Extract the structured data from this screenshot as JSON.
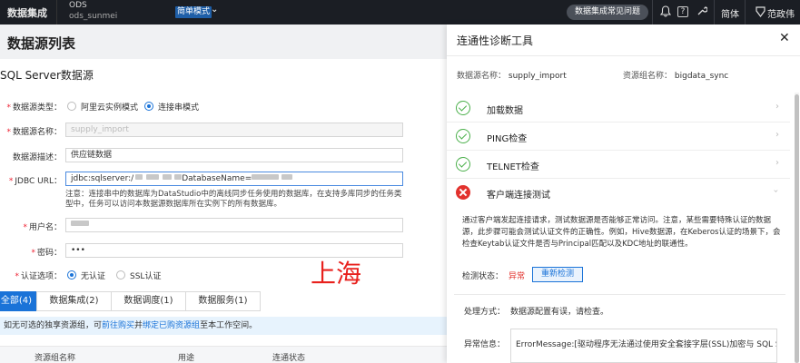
{
  "topbar": {
    "brand": "数据集成",
    "workspace_name": "ODS",
    "workspace_id": "ods_sunmei",
    "mode": "简单模式",
    "faq": "数据集成常见问题",
    "language": "简体",
    "user": "范政伟"
  },
  "page": {
    "title": "数据源列表",
    "subtitle": "SQL Server数据源"
  },
  "form": {
    "type_label": "数据源类型：",
    "type_opt1": "阿里云实例模式",
    "type_opt2": "连接串模式",
    "name_label": "数据源名称：",
    "name_value": "supply_import",
    "desc_label": "数据源描述：",
    "desc_value": "供应链数据",
    "jdbc_label": "JDBC URL：",
    "jdbc_prefix": "jdbc:sqlserver:/",
    "jdbc_mid": "DatabaseName=",
    "jdbc_note": "注意：连接串中的数据库为DataStudio中的离线同步任务使用的数据库，在支持多库同步的任务类型中，任务可以访问本数据源数据库所在实例下的所有数据库。",
    "user_label": "用户名：",
    "pwd_label": "密码：",
    "pwd_value": "•••",
    "auth_label": "认证选项：",
    "auth_opt1": "无认证",
    "auth_opt2": "SSL认证"
  },
  "overlay_text": "上海",
  "tabs": [
    "全部(4)",
    "数据集成(2)",
    "数据调度(1)",
    "数据服务(1)"
  ],
  "tip": {
    "t1": "如无可选的独享资源组，可",
    "link1": "前往购买",
    "t2": "并",
    "link2": "绑定已购资源组",
    "t3": "至本工作空间。"
  },
  "table_headers": [
    "资源组名称",
    "用途",
    "连通状态"
  ],
  "panel": {
    "title": "连通性诊断工具",
    "ds_label": "数据源名称：",
    "ds_value": "supply_import",
    "rg_label": "资源组名称：",
    "rg_value": "bigdata_sync",
    "checks": [
      {
        "name": "加载数据",
        "status": "ok"
      },
      {
        "name": "PING检查",
        "status": "ok"
      },
      {
        "name": "TELNET检查",
        "status": "ok"
      },
      {
        "name": "客户端连接测试",
        "status": "error"
      }
    ],
    "description": "通过客户端发起连接请求，测试数据源是否能够正常访问。注意，某些需要特殊认证的数据源，此步骤可能会测试认证文件的正确性。例如，Hive数据源，在Keberos认证的场景下，会检查Keytab认证文件是否与Principal匹配以及KDC地址的联通性。",
    "status_label": "检测状态：",
    "status_value": "异常",
    "recheck": "重新检测",
    "method_label": "处理方式：",
    "method_value": "数据源配置有误，请检查。",
    "exception_label": "异常信息：",
    "exception_value": "ErrorMessage:[驱动程序无法通过使用安全套接字层(SSL)加密与 SQL Server 建"
  }
}
